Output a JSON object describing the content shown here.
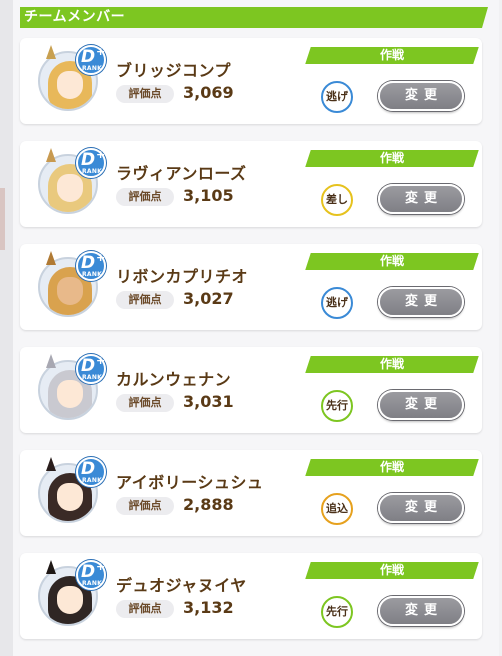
{
  "header": {
    "title": "チームメンバー"
  },
  "colors": {
    "accent_green": "#7dc621",
    "text_brown": "#5a3a16",
    "button_gray": "#8a8a90",
    "rank_blue": "#3a8ad6"
  },
  "members": [
    {
      "name": "ブリッジコンプ",
      "score_label": "評価点",
      "score": "3,069",
      "rank": "D",
      "rank_plus": "+",
      "rank_word": "RANK",
      "strategy_label": "作戦",
      "strategy": "逃げ",
      "strategy_color": "#3a8ad6",
      "change_label": "変更",
      "hair": "#e8b85a",
      "ear": "#c8a050",
      "face": "#fde8d6"
    },
    {
      "name": "ラヴィアンローズ",
      "score_label": "評価点",
      "score": "3,105",
      "rank": "D",
      "rank_plus": "+",
      "rank_word": "RANK",
      "strategy_label": "作戦",
      "strategy": "差し",
      "strategy_color": "#e6c21e",
      "change_label": "変更",
      "hair": "#e9c97e",
      "ear": "#c89a50",
      "face": "#fde8d6"
    },
    {
      "name": "リボンカプリチオ",
      "score_label": "評価点",
      "score": "3,027",
      "rank": "D",
      "rank_plus": "+",
      "rank_word": "RANK",
      "strategy_label": "作戦",
      "strategy": "逃げ",
      "strategy_color": "#3a8ad6",
      "change_label": "変更",
      "hair": "#d9a24e",
      "ear": "#b07a34",
      "face": "#e8b98a"
    },
    {
      "name": "カルンウェナン",
      "score_label": "評価点",
      "score": "3,031",
      "rank": "D",
      "rank_plus": "+",
      "rank_word": "RANK",
      "strategy_label": "作戦",
      "strategy": "先行",
      "strategy_color": "#7dc621",
      "change_label": "変更",
      "hair": "#c9c9d0",
      "ear": "#a8a8b2",
      "face": "#fde8d6"
    },
    {
      "name": "アイボリーシュシュ",
      "score_label": "評価点",
      "score": "2,888",
      "rank": "D",
      "rank_plus": "",
      "rank_word": "RANK",
      "strategy_label": "作戦",
      "strategy": "追込",
      "strategy_color": "#e6a11e",
      "change_label": "変更",
      "hair": "#3a2a26",
      "ear": "#2a1e1c",
      "face": "#fde8d6"
    },
    {
      "name": "デュオジャヌイヤ",
      "score_label": "評価点",
      "score": "3,132",
      "rank": "D",
      "rank_plus": "+",
      "rank_word": "RANK",
      "strategy_label": "作戦",
      "strategy": "先行",
      "strategy_color": "#7dc621",
      "change_label": "変更",
      "hair": "#2f2624",
      "ear": "#1f1816",
      "face": "#fde8d6"
    }
  ]
}
